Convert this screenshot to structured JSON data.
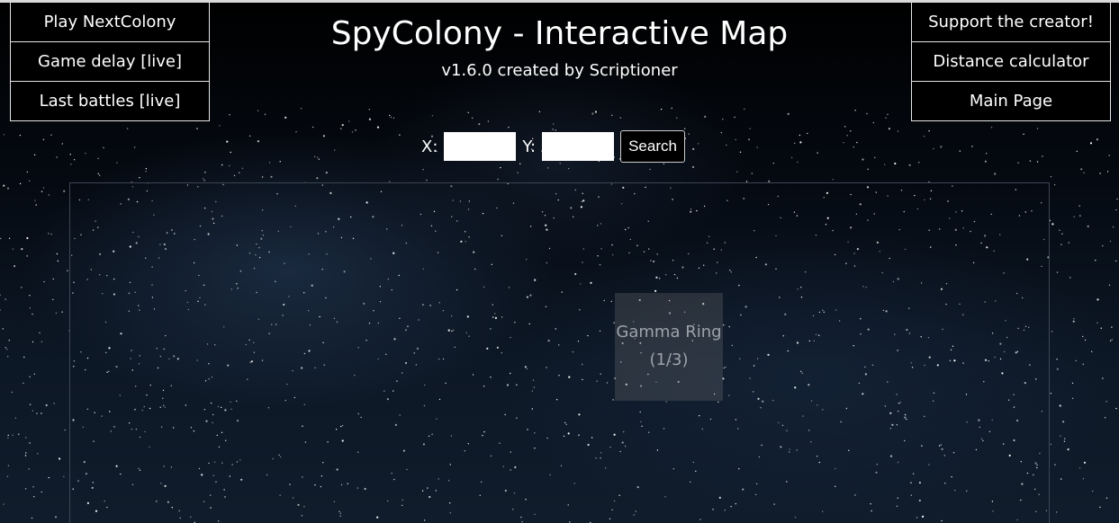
{
  "left_nav": {
    "items": [
      {
        "label": "Play NextColony"
      },
      {
        "label": "Game delay [live]"
      },
      {
        "label": "Last battles [live]"
      }
    ]
  },
  "right_nav": {
    "items": [
      {
        "label": "Support the creator!"
      },
      {
        "label": "Distance calculator"
      },
      {
        "label": "Main Page"
      }
    ]
  },
  "header": {
    "title": "SpyColony - Interactive Map",
    "subtitle": "v1.6.0 created by Scriptioner"
  },
  "search": {
    "x_label": "X:",
    "x_value": "",
    "y_label": "Y:",
    "y_value": "",
    "button_label": "Search"
  },
  "map": {
    "sector": {
      "name": "Gamma Ring",
      "count": "(1/3)"
    }
  },
  "colors": {
    "background": "#000000",
    "text": "#ffffff",
    "nav_border": "#e6e6e6",
    "sector_overlay": "#787878",
    "sector_text": "#9da3aa"
  }
}
